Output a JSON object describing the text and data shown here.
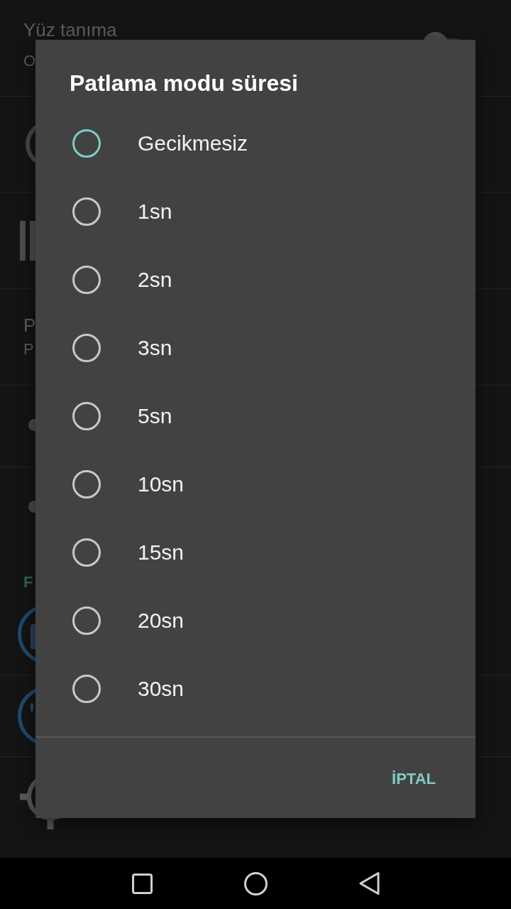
{
  "background": {
    "sections": [
      {
        "rows": [
          {
            "kind": "toggle",
            "title": "Yüz tanıma",
            "subtitle": "O",
            "on": false
          },
          {
            "kind": "ring"
          },
          {
            "kind": "bars"
          },
          {
            "kind": "text",
            "title": "P",
            "subtitle": "P"
          },
          {
            "kind": "dot"
          },
          {
            "kind": "dot"
          }
        ]
      },
      {
        "header": "F",
        "rows": [
          {
            "kind": "bluering"
          },
          {
            "kind": "bluetimer"
          },
          {
            "kind": "crosshair"
          }
        ]
      }
    ]
  },
  "dialog": {
    "title": "Patlama modu süresi",
    "options": [
      {
        "label": "Gecikmesiz",
        "selected": true
      },
      {
        "label": "1sn",
        "selected": false
      },
      {
        "label": "2sn",
        "selected": false
      },
      {
        "label": "3sn",
        "selected": false
      },
      {
        "label": "5sn",
        "selected": false
      },
      {
        "label": "10sn",
        "selected": false
      },
      {
        "label": "15sn",
        "selected": false
      },
      {
        "label": "20sn",
        "selected": false
      },
      {
        "label": "30sn",
        "selected": false
      }
    ],
    "buttons": [
      "İPTAL"
    ]
  }
}
